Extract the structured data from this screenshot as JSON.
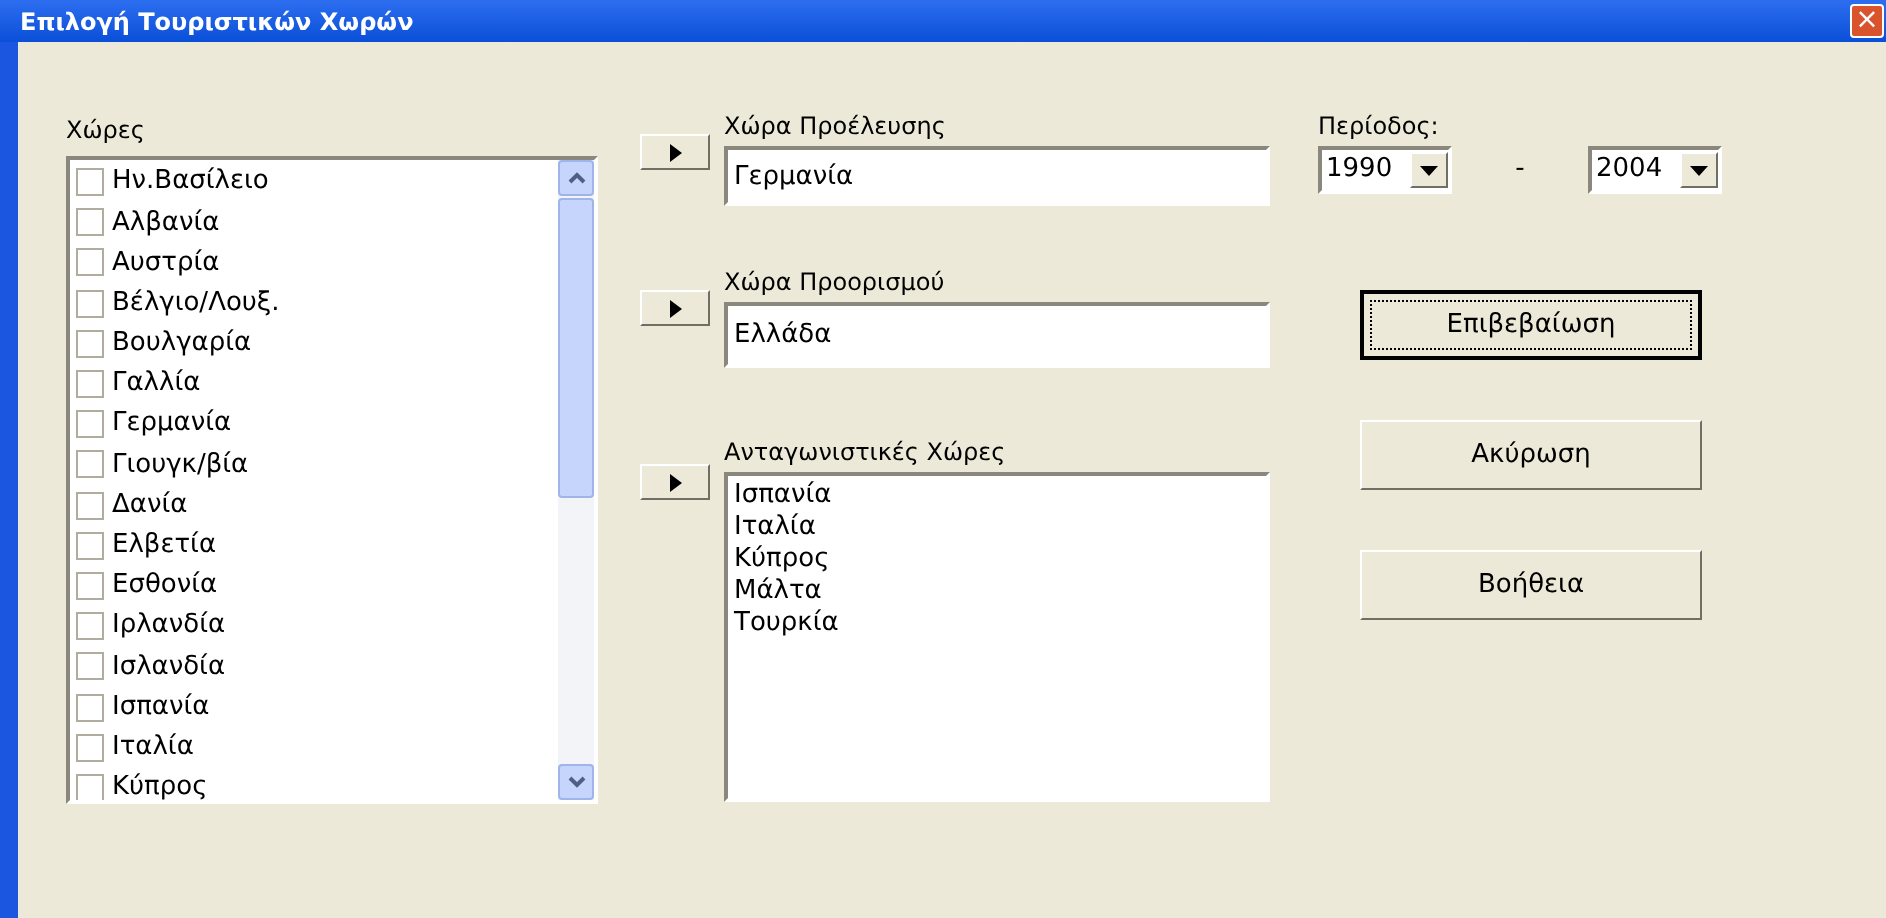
{
  "window": {
    "title": "Επιλογή Τουριστικών Χωρών",
    "close": "×"
  },
  "countries": {
    "label": "Χώρες",
    "items": [
      {
        "name": "Ην.Βασίλειο",
        "checked": false
      },
      {
        "name": "Αλβανία",
        "checked": false
      },
      {
        "name": "Αυστρία",
        "checked": false
      },
      {
        "name": "Βέλγιο/Λουξ.",
        "checked": false
      },
      {
        "name": "Βουλγαρία",
        "checked": false
      },
      {
        "name": "Γαλλία",
        "checked": false
      },
      {
        "name": "Γερμανία",
        "checked": false
      },
      {
        "name": "Γιουγκ/βία",
        "checked": false
      },
      {
        "name": "Δανία",
        "checked": false
      },
      {
        "name": "Ελβετία",
        "checked": false
      },
      {
        "name": "Εσθονία",
        "checked": false
      },
      {
        "name": "Ιρλανδία",
        "checked": false
      },
      {
        "name": "Ισλανδία",
        "checked": false
      },
      {
        "name": "Ισπανία",
        "checked": false
      },
      {
        "name": "Ιταλία",
        "checked": false
      },
      {
        "name": "Κύπρος",
        "checked": false
      }
    ]
  },
  "origin": {
    "label": "Χώρα Προέλευσης",
    "value": "Γερμανία"
  },
  "destination": {
    "label": "Χώρα Προορισμού",
    "value": "Ελλάδα"
  },
  "competitors": {
    "label": "Ανταγωνιστικές Χώρες",
    "items": [
      "Ισπανία",
      "Ιταλία",
      "Κύπρος",
      "Μάλτα",
      "Τουρκία"
    ]
  },
  "period": {
    "label": "Περίοδος:",
    "from": "1990",
    "separator": "-",
    "to": "2004"
  },
  "buttons": [
    {
      "label": "Επιβεβαίωση",
      "focused": true
    },
    {
      "label": "Ακύρωση",
      "focused": false
    },
    {
      "label": "Βοήθεια",
      "focused": false
    }
  ]
}
